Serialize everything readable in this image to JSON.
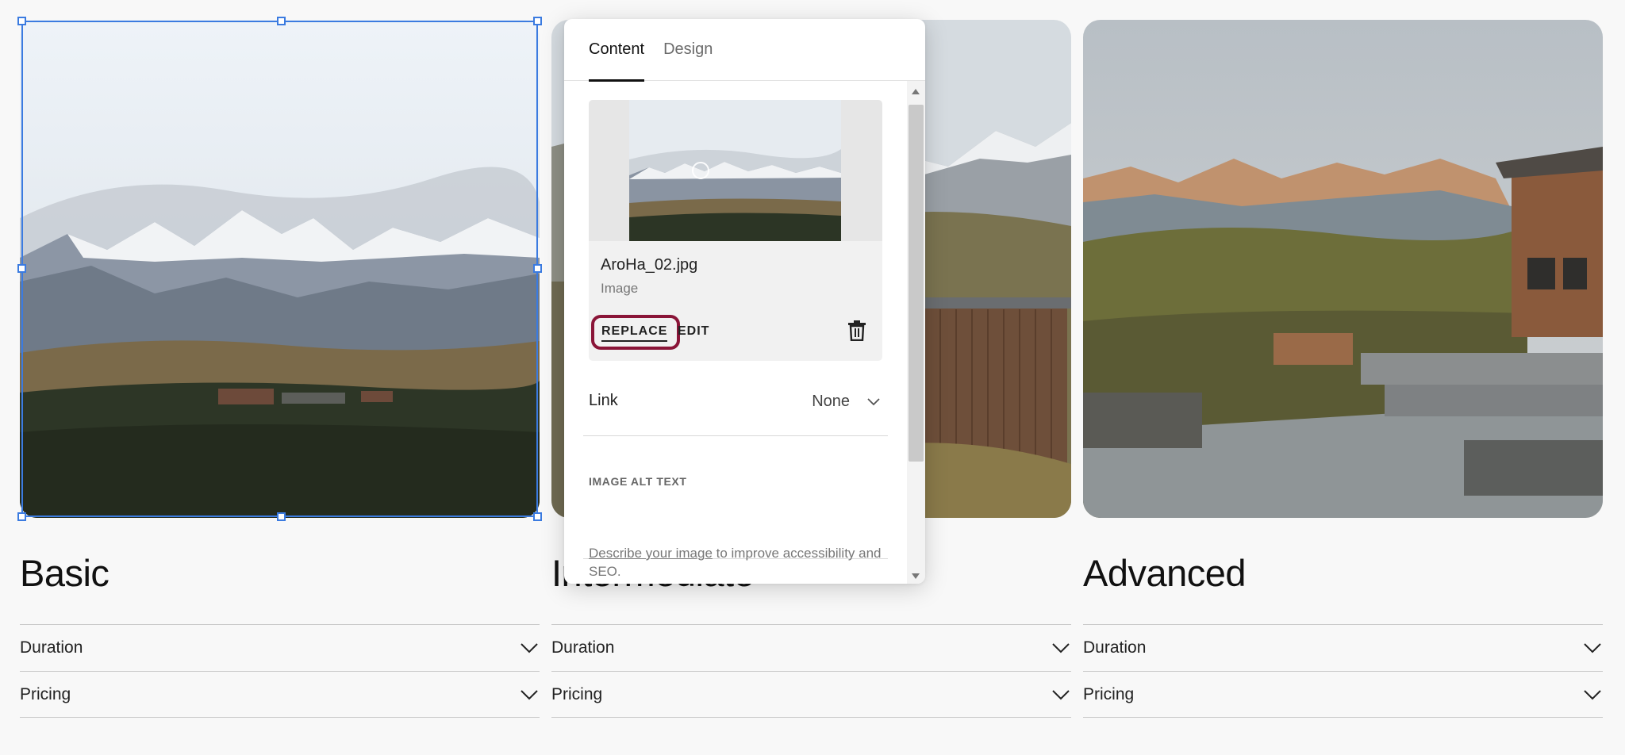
{
  "columns": [
    {
      "title": "Basic",
      "rows": [
        {
          "label": "Duration"
        },
        {
          "label": "Pricing"
        }
      ]
    },
    {
      "title": "Intermediate",
      "rows": [
        {
          "label": "Duration"
        },
        {
          "label": "Pricing"
        }
      ]
    },
    {
      "title": "Advanced",
      "rows": [
        {
          "label": "Duration"
        },
        {
          "label": "Pricing"
        }
      ]
    }
  ],
  "panel": {
    "tabs": [
      {
        "label": "Content",
        "active": true
      },
      {
        "label": "Design",
        "active": false
      }
    ],
    "image": {
      "file_name": "AroHa_02.jpg",
      "file_type": "Image",
      "replace_label": "REPLACE",
      "edit_label": "EDIT"
    },
    "link": {
      "label": "Link",
      "value": "None"
    },
    "alt_text": {
      "label": "IMAGE ALT TEXT",
      "value": "",
      "help_link": "Describe your image",
      "help_rest": " to improve accessibility and SEO."
    }
  },
  "colors": {
    "selection": "#3b7be0",
    "highlight_ring": "#8a1538",
    "page_bg": "#f8f8f8"
  },
  "icons": [
    "chevron-down-icon",
    "trash-icon",
    "focal-point-icon",
    "scroll-up-icon",
    "scroll-down-icon"
  ]
}
